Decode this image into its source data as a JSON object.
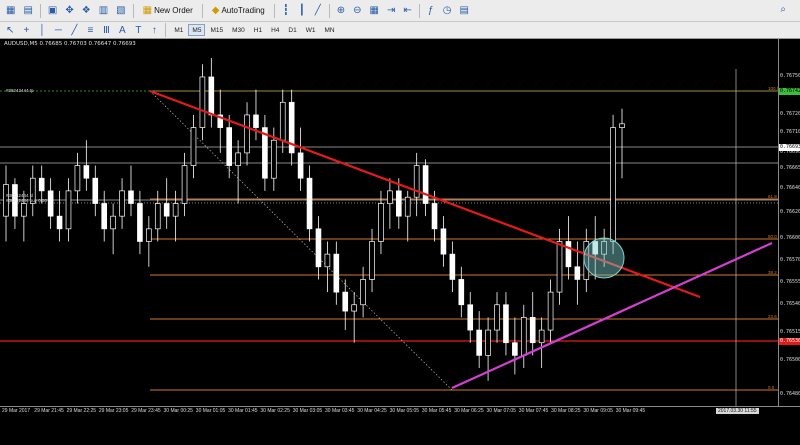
{
  "toolbar": {
    "new_order_label": "New Order",
    "autotrading_label": "AutoTrading",
    "timeframes": [
      "M1",
      "M5",
      "M15",
      "M30",
      "H1",
      "H4",
      "D1",
      "W1",
      "MN"
    ],
    "active_timeframe": "M5"
  },
  "chart": {
    "title": "AUDUSD,M5  0.76685 0.76703 0.76647 0.76693",
    "labels": {
      "order_top": "#38242444 tp",
      "order_sl": "#38242444 sl",
      "order_buy": "#38242444 buy 0.50"
    },
    "fib_levels": [
      "100.0",
      "61.8",
      "50.0",
      "38.2",
      "23.6",
      "0.0"
    ],
    "price_labels": [
      "0.76750",
      "0.76720",
      "0.76710",
      "0.76690",
      "0.76665",
      "0.76640",
      "0.76620",
      "0.76600",
      "0.76570",
      "0.76555",
      "0.76540",
      "0.76515",
      "0.76500",
      "0.76480"
    ],
    "price_tags": {
      "green_top": "0.76742",
      "current": "0.76693",
      "red": "0.76530"
    },
    "time_labels": [
      "29 Mar 2017",
      "29 Mar 21:45",
      "29 Mar 22:25",
      "29 Mar 23:05",
      "29 Mar 23:45",
      "30 Mar 00:25",
      "30 Mar 01:05",
      "30 Mar 01:45",
      "30 Mar 02:25",
      "30 Mar 03:05",
      "30 Mar 03:45",
      "30 Mar 04:25",
      "30 Mar 05:05",
      "30 Mar 05:45",
      "30 Mar 06:25",
      "30 Mar 07:05",
      "30 Mar 07:45",
      "30 Mar 08:25",
      "30 Mar 09:05",
      "30 Mar 09:45"
    ],
    "crosshair_time": "2017.03.30 11:55",
    "colors": {
      "candle": "#ffffff",
      "candle_bull_fill": "#000000",
      "candle_bear_fill": "#ffffff",
      "downtrend": "#e31a1a",
      "uptrend": "#d33fd3",
      "fib": "#d4782a",
      "order_line": "#b6b6b6",
      "red_level": "#e31a1a",
      "green_level": "#3bbf3b",
      "highlight_circle": "#7fd1d0"
    }
  },
  "chart_data": {
    "type": "candlestick",
    "symbol": "AUDUSD",
    "timeframe": "M5",
    "ylim": [
      0.7647,
      0.7676
    ],
    "candles": [
      [
        0.7662,
        0.7666,
        0.766,
        0.76645
      ],
      [
        0.76645,
        0.7665,
        0.7661,
        0.7662
      ],
      [
        0.7662,
        0.7664,
        0.766,
        0.7663
      ],
      [
        0.7663,
        0.7666,
        0.7662,
        0.7665
      ],
      [
        0.7665,
        0.7666,
        0.7663,
        0.7664
      ],
      [
        0.7664,
        0.7665,
        0.7661,
        0.7662
      ],
      [
        0.7662,
        0.7664,
        0.766,
        0.7661
      ],
      [
        0.7661,
        0.7665,
        0.766,
        0.7664
      ],
      [
        0.7664,
        0.7667,
        0.7663,
        0.7666
      ],
      [
        0.7666,
        0.7668,
        0.7664,
        0.7665
      ],
      [
        0.7665,
        0.7666,
        0.7662,
        0.7663
      ],
      [
        0.7663,
        0.7664,
        0.766,
        0.7661
      ],
      [
        0.7661,
        0.7663,
        0.7659,
        0.7662
      ],
      [
        0.7662,
        0.7665,
        0.7661,
        0.7664
      ],
      [
        0.7664,
        0.7666,
        0.7662,
        0.7663
      ],
      [
        0.7663,
        0.7664,
        0.7659,
        0.766
      ],
      [
        0.766,
        0.7662,
        0.7658,
        0.7661
      ],
      [
        0.7661,
        0.7664,
        0.766,
        0.7663
      ],
      [
        0.7663,
        0.7665,
        0.7661,
        0.7662
      ],
      [
        0.7662,
        0.7664,
        0.766,
        0.7663
      ],
      [
        0.7663,
        0.7667,
        0.7662,
        0.7666
      ],
      [
        0.7666,
        0.767,
        0.7665,
        0.7669
      ],
      [
        0.7669,
        0.7674,
        0.7668,
        0.7673
      ],
      [
        0.7673,
        0.76745,
        0.7669,
        0.767
      ],
      [
        0.767,
        0.7672,
        0.7667,
        0.7669
      ],
      [
        0.7669,
        0.767,
        0.7665,
        0.7666
      ],
      [
        0.7666,
        0.7668,
        0.7663,
        0.7667
      ],
      [
        0.7667,
        0.7671,
        0.7666,
        0.767
      ],
      [
        0.767,
        0.7672,
        0.7668,
        0.7669
      ],
      [
        0.7669,
        0.767,
        0.7664,
        0.7665
      ],
      [
        0.7665,
        0.7669,
        0.7664,
        0.7668
      ],
      [
        0.7668,
        0.7672,
        0.7667,
        0.7671
      ],
      [
        0.7671,
        0.7672,
        0.7666,
        0.7667
      ],
      [
        0.7667,
        0.7669,
        0.7664,
        0.7665
      ],
      [
        0.7665,
        0.7666,
        0.766,
        0.7661
      ],
      [
        0.7661,
        0.7662,
        0.7657,
        0.7658
      ],
      [
        0.7658,
        0.766,
        0.7656,
        0.7659
      ],
      [
        0.7659,
        0.766,
        0.7655,
        0.7656
      ],
      [
        0.7656,
        0.7657,
        0.7653,
        0.76545
      ],
      [
        0.76545,
        0.7656,
        0.7652,
        0.7655
      ],
      [
        0.7655,
        0.7658,
        0.7654,
        0.7657
      ],
      [
        0.7657,
        0.7661,
        0.7656,
        0.766
      ],
      [
        0.766,
        0.7664,
        0.7659,
        0.7663
      ],
      [
        0.7663,
        0.7665,
        0.7661,
        0.7664
      ],
      [
        0.7664,
        0.7665,
        0.7661,
        0.7662
      ],
      [
        0.7662,
        0.7664,
        0.766,
        0.76635
      ],
      [
        0.76635,
        0.7667,
        0.7662,
        0.7666
      ],
      [
        0.7666,
        0.76665,
        0.7662,
        0.7663
      ],
      [
        0.7663,
        0.7664,
        0.766,
        0.7661
      ],
      [
        0.7661,
        0.7662,
        0.7658,
        0.7659
      ],
      [
        0.7659,
        0.766,
        0.7656,
        0.7657
      ],
      [
        0.7657,
        0.7658,
        0.7654,
        0.7655
      ],
      [
        0.7655,
        0.7656,
        0.7652,
        0.7653
      ],
      [
        0.7653,
        0.76545,
        0.765,
        0.7651
      ],
      [
        0.7651,
        0.7654,
        0.7649,
        0.7653
      ],
      [
        0.7653,
        0.7656,
        0.7652,
        0.7655
      ],
      [
        0.7655,
        0.7656,
        0.7651,
        0.7652
      ],
      [
        0.7652,
        0.7654,
        0.76495,
        0.7651
      ],
      [
        0.7651,
        0.7655,
        0.765,
        0.7654
      ],
      [
        0.7654,
        0.7656,
        0.7651,
        0.7652
      ],
      [
        0.7652,
        0.7654,
        0.765,
        0.7653
      ],
      [
        0.7653,
        0.7657,
        0.7652,
        0.7656
      ],
      [
        0.7656,
        0.7661,
        0.7655,
        0.766
      ],
      [
        0.766,
        0.7662,
        0.7657,
        0.7658
      ],
      [
        0.7658,
        0.766,
        0.7655,
        0.7657
      ],
      [
        0.7657,
        0.7661,
        0.7656,
        0.766
      ],
      [
        0.766,
        0.7662,
        0.7657,
        0.7659
      ],
      [
        0.7659,
        0.7661,
        0.7658,
        0.766
      ],
      [
        0.766,
        0.767,
        0.7659,
        0.7669
      ],
      [
        0.7669,
        0.76705,
        0.7665,
        0.76693
      ]
    ]
  }
}
